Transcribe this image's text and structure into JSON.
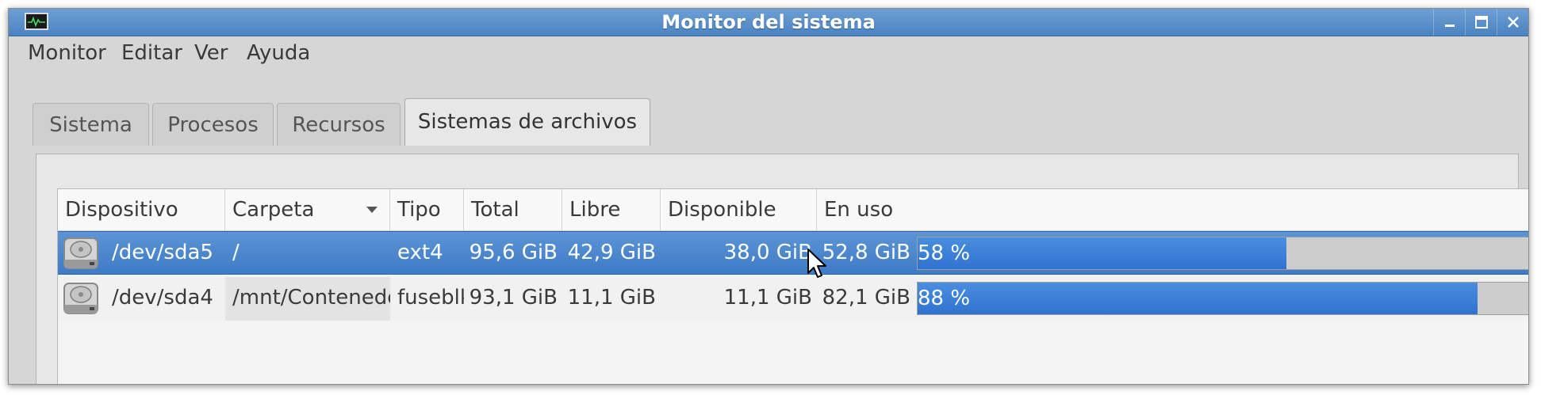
{
  "window": {
    "title": "Monitor del sistema"
  },
  "menubar": {
    "items": [
      "Monitor",
      "Editar",
      "Ver",
      "Ayuda"
    ]
  },
  "tabs": [
    {
      "label": "Sistema",
      "active": false
    },
    {
      "label": "Procesos",
      "active": false
    },
    {
      "label": "Recursos",
      "active": false
    },
    {
      "label": "Sistemas de archivos",
      "active": true
    }
  ],
  "table": {
    "columns": [
      "Dispositivo",
      "Carpeta",
      "Tipo",
      "Total",
      "Libre",
      "Disponible",
      "En uso"
    ],
    "sorted_column": "Carpeta",
    "rows": [
      {
        "device": "/dev/sda5",
        "folder": "/",
        "type": "ext4",
        "total": "95,6 GiB",
        "free": "42,9 GiB",
        "available": "38,0 GiB",
        "used": "52,8 GiB",
        "used_percent": 58,
        "used_percent_label": "58 %",
        "selected": true
      },
      {
        "device": "/dev/sda4",
        "folder": "/mnt/Contenedor",
        "type": "fuseblk",
        "total": "93,1 GiB",
        "free": "11,1 GiB",
        "available": "11,1 GiB",
        "used": "82,1 GiB",
        "used_percent": 88,
        "used_percent_label": "88 %",
        "selected": false
      }
    ]
  },
  "colors": {
    "titlebar": "#5b8fcb",
    "selection": "#4a85cc",
    "progress": "#3a80d6"
  },
  "icons": [
    "system-monitor-app-icon",
    "minimize-icon",
    "maximize-icon",
    "close-icon",
    "sort-descending-icon",
    "hard-disk-icon",
    "mouse-cursor-icon"
  ]
}
